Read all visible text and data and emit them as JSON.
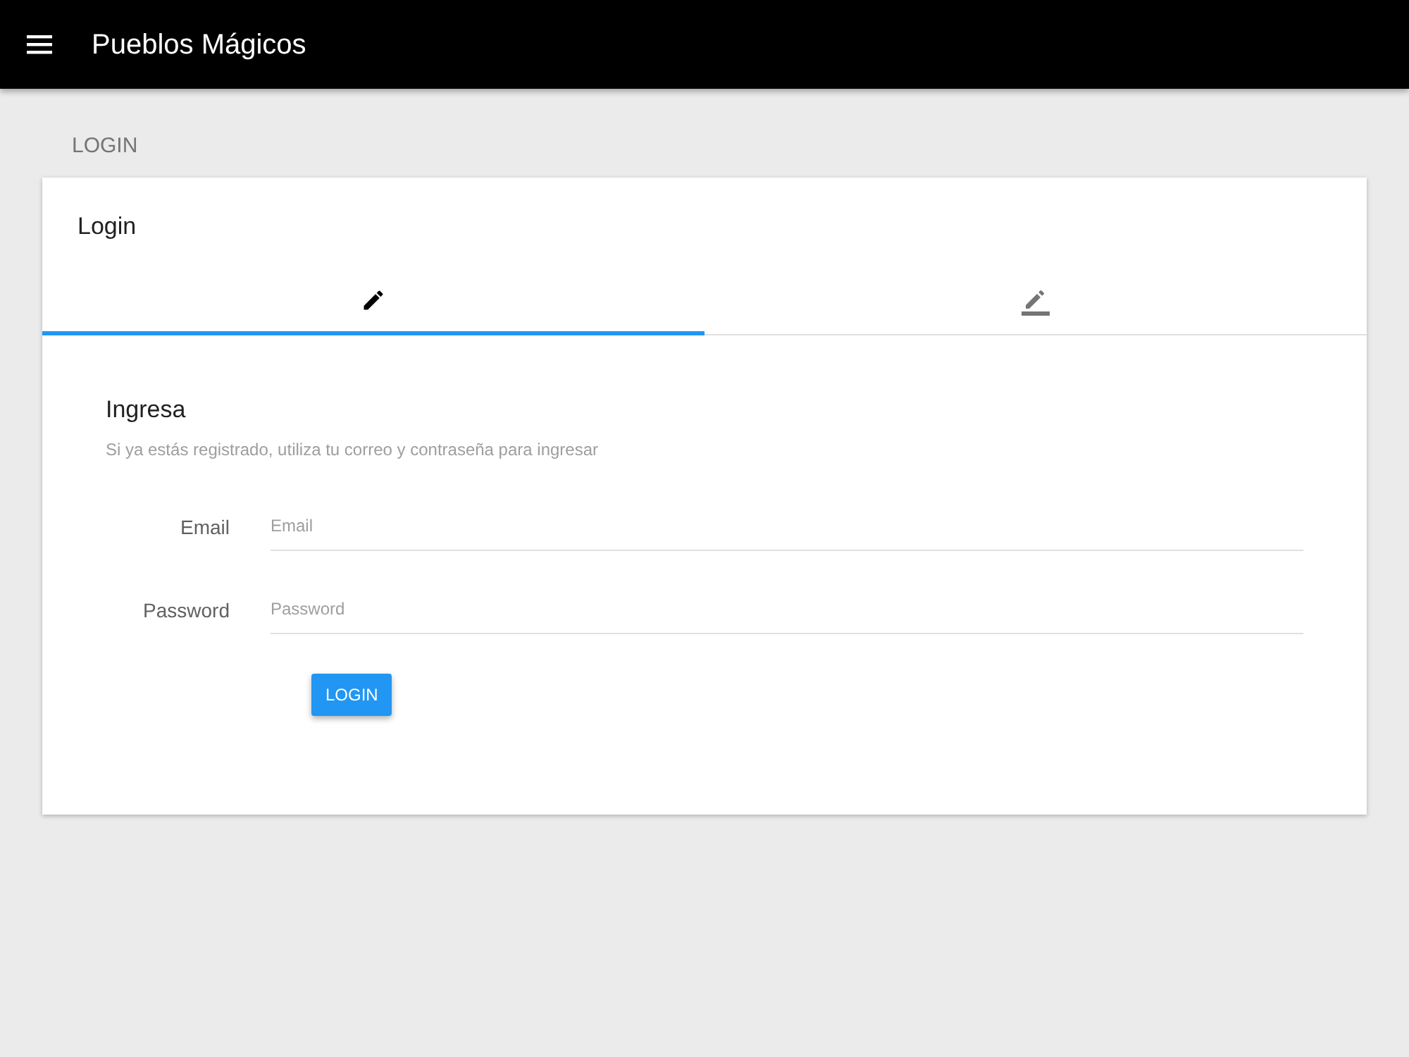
{
  "app_bar": {
    "title": "Pueblos Mágicos"
  },
  "page_title": "LOGIN",
  "card": {
    "title": "Login",
    "tabs": [
      {
        "kind": "pencil",
        "selected": true
      },
      {
        "kind": "pencil-line",
        "selected": false
      }
    ],
    "form": {
      "heading": "Ingresa",
      "description": "Si ya estás registrado, utiliza tu correo y contraseña para ingresar",
      "fields": [
        {
          "label": "Email",
          "placeholder": "Email"
        },
        {
          "label": "Password",
          "placeholder": "Password"
        }
      ],
      "submit": "LOGIN"
    }
  }
}
